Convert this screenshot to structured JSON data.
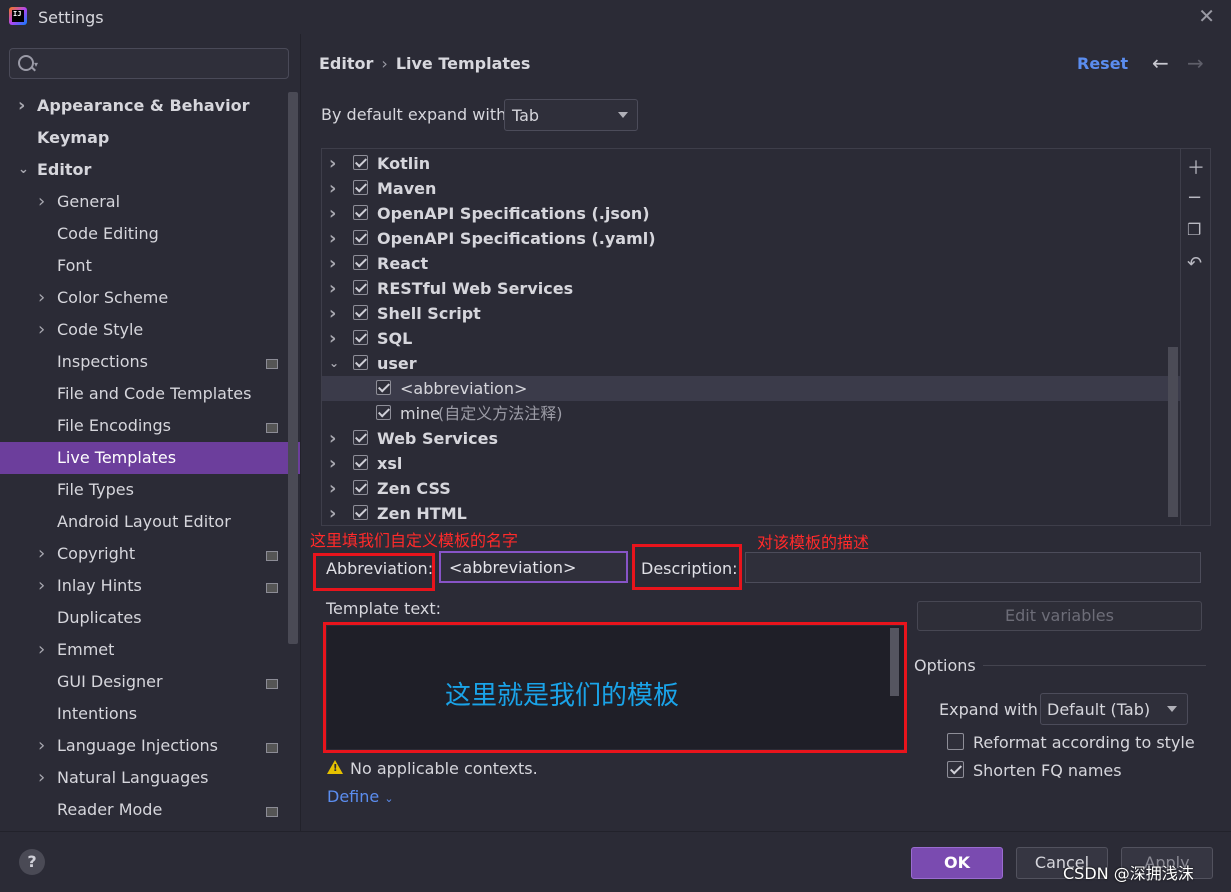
{
  "window": {
    "title": "Settings",
    "app_icon_text": "IJ"
  },
  "search": {
    "placeholder": ""
  },
  "sidebar": {
    "items": [
      {
        "label": "Appearance & Behavior",
        "level": 0,
        "expandable": true,
        "expanded": false,
        "bold": true,
        "badge": false,
        "selected": false
      },
      {
        "label": "Keymap",
        "level": 0,
        "expandable": false,
        "expanded": false,
        "bold": true,
        "badge": false,
        "selected": false
      },
      {
        "label": "Editor",
        "level": 0,
        "expandable": true,
        "expanded": true,
        "bold": true,
        "badge": false,
        "selected": false
      },
      {
        "label": "General",
        "level": 1,
        "expandable": true,
        "expanded": false,
        "bold": false,
        "badge": false,
        "selected": false
      },
      {
        "label": "Code Editing",
        "level": 1,
        "expandable": false,
        "expanded": false,
        "bold": false,
        "badge": false,
        "selected": false
      },
      {
        "label": "Font",
        "level": 1,
        "expandable": false,
        "expanded": false,
        "bold": false,
        "badge": false,
        "selected": false
      },
      {
        "label": "Color Scheme",
        "level": 1,
        "expandable": true,
        "expanded": false,
        "bold": false,
        "badge": false,
        "selected": false
      },
      {
        "label": "Code Style",
        "level": 1,
        "expandable": true,
        "expanded": false,
        "bold": false,
        "badge": false,
        "selected": false
      },
      {
        "label": "Inspections",
        "level": 1,
        "expandable": false,
        "expanded": false,
        "bold": false,
        "badge": true,
        "selected": false
      },
      {
        "label": "File and Code Templates",
        "level": 1,
        "expandable": false,
        "expanded": false,
        "bold": false,
        "badge": false,
        "selected": false
      },
      {
        "label": "File Encodings",
        "level": 1,
        "expandable": false,
        "expanded": false,
        "bold": false,
        "badge": true,
        "selected": false
      },
      {
        "label": "Live Templates",
        "level": 1,
        "expandable": false,
        "expanded": false,
        "bold": false,
        "badge": false,
        "selected": true
      },
      {
        "label": "File Types",
        "level": 1,
        "expandable": false,
        "expanded": false,
        "bold": false,
        "badge": false,
        "selected": false
      },
      {
        "label": "Android Layout Editor",
        "level": 1,
        "expandable": false,
        "expanded": false,
        "bold": false,
        "badge": false,
        "selected": false
      },
      {
        "label": "Copyright",
        "level": 1,
        "expandable": true,
        "expanded": false,
        "bold": false,
        "badge": true,
        "selected": false
      },
      {
        "label": "Inlay Hints",
        "level": 1,
        "expandable": true,
        "expanded": false,
        "bold": false,
        "badge": true,
        "selected": false
      },
      {
        "label": "Duplicates",
        "level": 1,
        "expandable": false,
        "expanded": false,
        "bold": false,
        "badge": false,
        "selected": false
      },
      {
        "label": "Emmet",
        "level": 1,
        "expandable": true,
        "expanded": false,
        "bold": false,
        "badge": false,
        "selected": false
      },
      {
        "label": "GUI Designer",
        "level": 1,
        "expandable": false,
        "expanded": false,
        "bold": false,
        "badge": true,
        "selected": false
      },
      {
        "label": "Intentions",
        "level": 1,
        "expandable": false,
        "expanded": false,
        "bold": false,
        "badge": false,
        "selected": false
      },
      {
        "label": "Language Injections",
        "level": 1,
        "expandable": true,
        "expanded": false,
        "bold": false,
        "badge": true,
        "selected": false
      },
      {
        "label": "Natural Languages",
        "level": 1,
        "expandable": true,
        "expanded": false,
        "bold": false,
        "badge": false,
        "selected": false
      },
      {
        "label": "Reader Mode",
        "level": 1,
        "expandable": false,
        "expanded": false,
        "bold": false,
        "badge": true,
        "selected": false
      }
    ]
  },
  "header": {
    "crumb_parent": "Editor",
    "crumb_current": "Live Templates",
    "reset_label": "Reset",
    "back_icon": "arrow-left-icon",
    "forward_icon": "arrow-right-icon"
  },
  "expand_default": {
    "label": "By default expand with",
    "value": "Tab"
  },
  "templates": [
    {
      "name": "Kotlin",
      "type": "group",
      "expanded": false,
      "checked": true,
      "desc": ""
    },
    {
      "name": "Maven",
      "type": "group",
      "expanded": false,
      "checked": true,
      "desc": ""
    },
    {
      "name": "OpenAPI Specifications (.json)",
      "type": "group",
      "expanded": false,
      "checked": true,
      "desc": ""
    },
    {
      "name": "OpenAPI Specifications (.yaml)",
      "type": "group",
      "expanded": false,
      "checked": true,
      "desc": ""
    },
    {
      "name": "React",
      "type": "group",
      "expanded": false,
      "checked": true,
      "desc": ""
    },
    {
      "name": "RESTful Web Services",
      "type": "group",
      "expanded": false,
      "checked": true,
      "desc": ""
    },
    {
      "name": "Shell Script",
      "type": "group",
      "expanded": false,
      "checked": true,
      "desc": ""
    },
    {
      "name": "SQL",
      "type": "group",
      "expanded": false,
      "checked": true,
      "desc": ""
    },
    {
      "name": "user",
      "type": "group",
      "expanded": true,
      "checked": true,
      "desc": ""
    },
    {
      "name": "<abbreviation>",
      "type": "item",
      "expanded": false,
      "checked": true,
      "desc": "",
      "selected": true
    },
    {
      "name": "mine",
      "type": "item",
      "expanded": false,
      "checked": true,
      "desc": "(自定义方法注释)"
    },
    {
      "name": "Web Services",
      "type": "group",
      "expanded": false,
      "checked": true,
      "desc": ""
    },
    {
      "name": "xsl",
      "type": "group",
      "expanded": false,
      "checked": true,
      "desc": ""
    },
    {
      "name": "Zen CSS",
      "type": "group",
      "expanded": false,
      "checked": true,
      "desc": ""
    },
    {
      "name": "Zen HTML",
      "type": "group",
      "expanded": false,
      "checked": true,
      "desc": ""
    }
  ],
  "toolbar": {
    "add_icon": "plus-icon",
    "remove_icon": "minus-icon",
    "copy_icon": "copy-icon",
    "restore_icon": "undo-icon"
  },
  "annotations": {
    "abbr_note": "这里填我们自定义模板的名字",
    "desc_note": "对该模板的描述",
    "template_note": "这里就是我们的模板"
  },
  "editor": {
    "abbr_label": "Abbreviation:",
    "abbr_value": "<abbreviation>",
    "desc_label": "Description:",
    "desc_value": "",
    "template_label": "Template text:",
    "edit_vars_label": "Edit variables",
    "warning_text": "No applicable contexts.",
    "define_label": "Define"
  },
  "options": {
    "title": "Options",
    "expand_label": "Expand with",
    "expand_value": "Default (Tab)",
    "reformat_label": "Reformat according to style",
    "reformat_checked": false,
    "shorten_label": "Shorten FQ names",
    "shorten_checked": true
  },
  "footer": {
    "help_label": "?",
    "ok_label": "OK",
    "cancel_label": "Cancel",
    "apply_label": "Apply"
  },
  "watermark": "CSDN @深拥浅沫",
  "colors": {
    "accent": "#6c3e9c",
    "link": "#5b8def",
    "annotation_red": "#e8141c",
    "annotation_blue": "#1aa3e8",
    "background": "#2b2b36"
  }
}
